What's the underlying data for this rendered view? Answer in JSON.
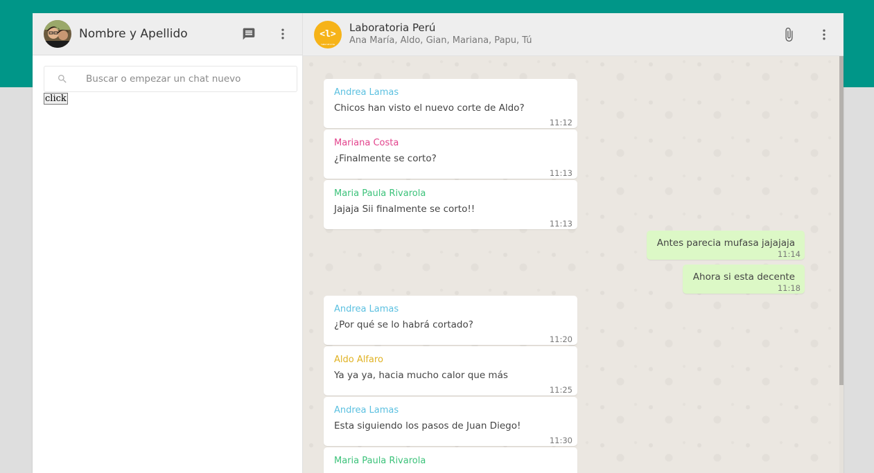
{
  "user": {
    "name": "Nombre y Apellido",
    "avatar_icon": "user-avatar-photo"
  },
  "search": {
    "placeholder": "Buscar o empezar un chat nuevo",
    "value": ""
  },
  "click_button": "click",
  "chat": {
    "avatar_text": "<l>",
    "avatar_subtext": "laboratoria",
    "title": "Laboratoria Perú",
    "members": "Ana María, Aldo, Gian, Mariana, Papu, Tú"
  },
  "colors": {
    "header_band": "#009688",
    "sent_bubble": "#dcf8c6",
    "received_bubble": "#ffffff",
    "group_avatar": "#f6b318"
  },
  "messages": [
    {
      "sender": "Andrea Lamas",
      "color": "#5bc0e0",
      "text": "Chicos han visto el nuevo corte de Aldo?",
      "time": "11:12"
    },
    {
      "sender": "Mariana Costa",
      "color": "#e2438c",
      "text": "¿Finalmente se corto?",
      "time": "11:13"
    },
    {
      "sender": "Maria Paula Rivarola",
      "color": "#3cc27a",
      "text": "Jajaja Sii finalmente se corto!!",
      "time": "11:13"
    },
    {
      "mine": true,
      "text": "Antes parecia mufasa jajajaja",
      "time": "11:14"
    },
    {
      "mine": true,
      "text": "Ahora si esta decente",
      "time": "11:18"
    },
    {
      "sender": "Andrea Lamas",
      "color": "#5bc0e0",
      "text": "¿Por qué se lo habrá cortado?",
      "time": "11:20"
    },
    {
      "sender": "Aldo Alfaro",
      "color": "#e0b223",
      "text": "Ya ya ya, hacia mucho calor que más",
      "time": "11:25"
    },
    {
      "sender": "Andrea Lamas",
      "color": "#5bc0e0",
      "text": "Esta siguiendo los pasos de Juan Diego!",
      "time": "11:30"
    },
    {
      "sender": "Maria Paula Rivarola",
      "color": "#3cc27a",
      "text": "",
      "time": ""
    }
  ]
}
